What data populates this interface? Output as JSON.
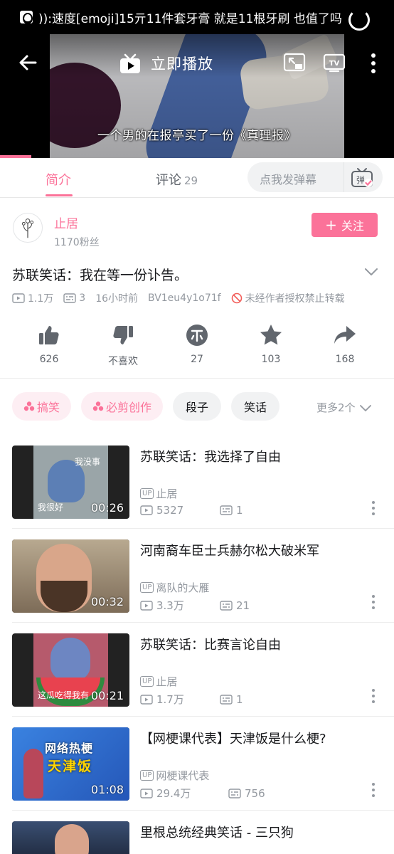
{
  "status_bar": {
    "ticker_text": ")):速度[emoji]15亓11件套牙膏 就是11根牙刷 也值了吗"
  },
  "player": {
    "subtitle": "一个男的在报亭买了一份《真理报》",
    "play_now_label": "立即播放",
    "progress_fraction": 0.08
  },
  "tabs": {
    "intro_label": "简介",
    "comment_label": "评论",
    "comment_count": "29",
    "danmaku_placeholder": "点我发弹幕",
    "danmaku_icon_char": "弹"
  },
  "uploader": {
    "name": "止居",
    "fans": "1170粉丝",
    "follow_label": "关注"
  },
  "video": {
    "title": "苏联笑话：我在等一份讣告。",
    "views": "1.1万",
    "danmaku_count": "3",
    "time_ago": "16小时前",
    "bvid": "BV1eu4y1o71f",
    "copyright_notice": "未经作者授权禁止转载"
  },
  "actions": {
    "like_count": "626",
    "dislike_label": "不喜欢",
    "coin_count": "27",
    "favorite_count": "103",
    "share_count": "168"
  },
  "tags": {
    "items": [
      "搞笑",
      "必剪创作",
      "段子",
      "笑话"
    ],
    "more_label": "更多2个"
  },
  "related": [
    {
      "title": "苏联笑话：我选择了自由",
      "up": "止居",
      "views": "5327",
      "danmaku": "1",
      "duration": "00:26",
      "thumb_caption_1": "我没事",
      "thumb_caption_2": "我很好"
    },
    {
      "title": "河南裔车臣士兵赫尔松大破米军",
      "up": "离队的大雁",
      "views": "3.3万",
      "danmaku": "21",
      "duration": "00:32"
    },
    {
      "title": "苏联笑话：比赛言论自由",
      "up": "止居",
      "views": "1.7万",
      "danmaku": "1",
      "duration": "00:21",
      "thumb_caption_1": "这瓜吃得我有"
    },
    {
      "title": "【网梗课代表】天津饭是什么梗?",
      "up": "网梗课代表",
      "views": "29.4万",
      "danmaku": "756",
      "duration": "01:08",
      "thumb_caption_1": "网络热梗",
      "thumb_caption_2": "天津饭"
    },
    {
      "title": "里根总统经典笑话 - 三只狗"
    }
  ],
  "up_badge": "UP",
  "colors": {
    "accent": "#fb7299",
    "text": "#18191c",
    "muted": "#9499a0",
    "tag_bg": "#f1f2f3"
  }
}
